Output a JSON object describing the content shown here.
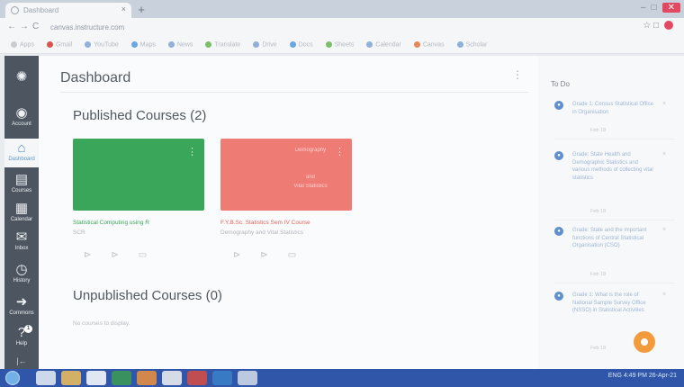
{
  "browser": {
    "tab_title": "Dashboard",
    "tab_close": "×",
    "new_tab": "+",
    "url": "canvas.instructure.com",
    "back": "←",
    "forward": "→",
    "reload": "C",
    "bookmarks": [
      "Apps",
      "Gmail",
      "YouTube",
      "Maps",
      "News",
      "Translate",
      "Drive",
      "Docs",
      "Sheets",
      "Calendar",
      "Canvas",
      "Scholar"
    ],
    "bookmark_colors": [
      "#c8ccd0",
      "#d9534f",
      "#8fb0d8",
      "#6aa7e0",
      "#8fb0d8",
      "#7bbf6a",
      "#8fb0d8",
      "#6aa7e0",
      "#7bbf6a",
      "#8fb0d8",
      "#e48a5a",
      "#8fb0d8"
    ]
  },
  "global_nav": {
    "items": [
      {
        "label": "",
        "icon": "canvas-logo-icon"
      },
      {
        "label": "Account",
        "icon": "account-icon"
      },
      {
        "label": "Dashboard",
        "icon": "dashboard-icon"
      },
      {
        "label": "Courses",
        "icon": "courses-icon"
      },
      {
        "label": "Calendar",
        "icon": "calendar-icon"
      },
      {
        "label": "Inbox",
        "icon": "inbox-icon"
      },
      {
        "label": "History",
        "icon": "history-icon"
      },
      {
        "label": "Commons",
        "icon": "commons-icon"
      },
      {
        "label": "Help",
        "icon": "help-icon"
      }
    ],
    "help_badge": "1",
    "collapse": "|←"
  },
  "dashboard": {
    "title": "Dashboard",
    "menu": "⋮",
    "published_title": "Published Courses (2)",
    "unpublished_title": "Unpublished Courses (0)",
    "no_courses": "No courses to display.",
    "cards": [
      {
        "color": "#3aa65a",
        "title": "Statistical Computing using R",
        "title_color": "#3aa65a",
        "subtitle": "SCR",
        "overlay": [
          "",
          "",
          ""
        ]
      },
      {
        "color": "#ee7b74",
        "title": "F.Y.B.Sc. Statistics Sem IV Course",
        "title_color": "#e8645c",
        "subtitle": "Demography and Vital Statistics",
        "overlay": [
          "Demography",
          "and",
          "Vital Statistics"
        ]
      }
    ]
  },
  "todo": {
    "title": "To Do",
    "items": [
      {
        "text": "Grade 1: Census Statistical Office in Organisation",
        "meta": "Feb 18"
      },
      {
        "text": "Grade: State Health and Demographic Statistics and various methods of collecting vital statistics",
        "meta": "Feb 18"
      },
      {
        "text": "Grade: State and the important functions of Central Statistical Organisation (CSO)",
        "meta": "Feb 18"
      },
      {
        "text": "Grade 1: What is the role of National Sample Survey Office (NSSO) in Statistical Activities",
        "meta": "Feb 18"
      }
    ]
  },
  "taskbar": {
    "apps": [
      "#e9eef6",
      "#f0c05a",
      "#ffffff",
      "#3b9b53",
      "#ef8f3c",
      "#f2f2f2",
      "#d94b41",
      "#3b80c9",
      "#d5dde9"
    ],
    "tray_text": "ENG  4:49 PM",
    "tray_date": "26-Apr-21"
  }
}
